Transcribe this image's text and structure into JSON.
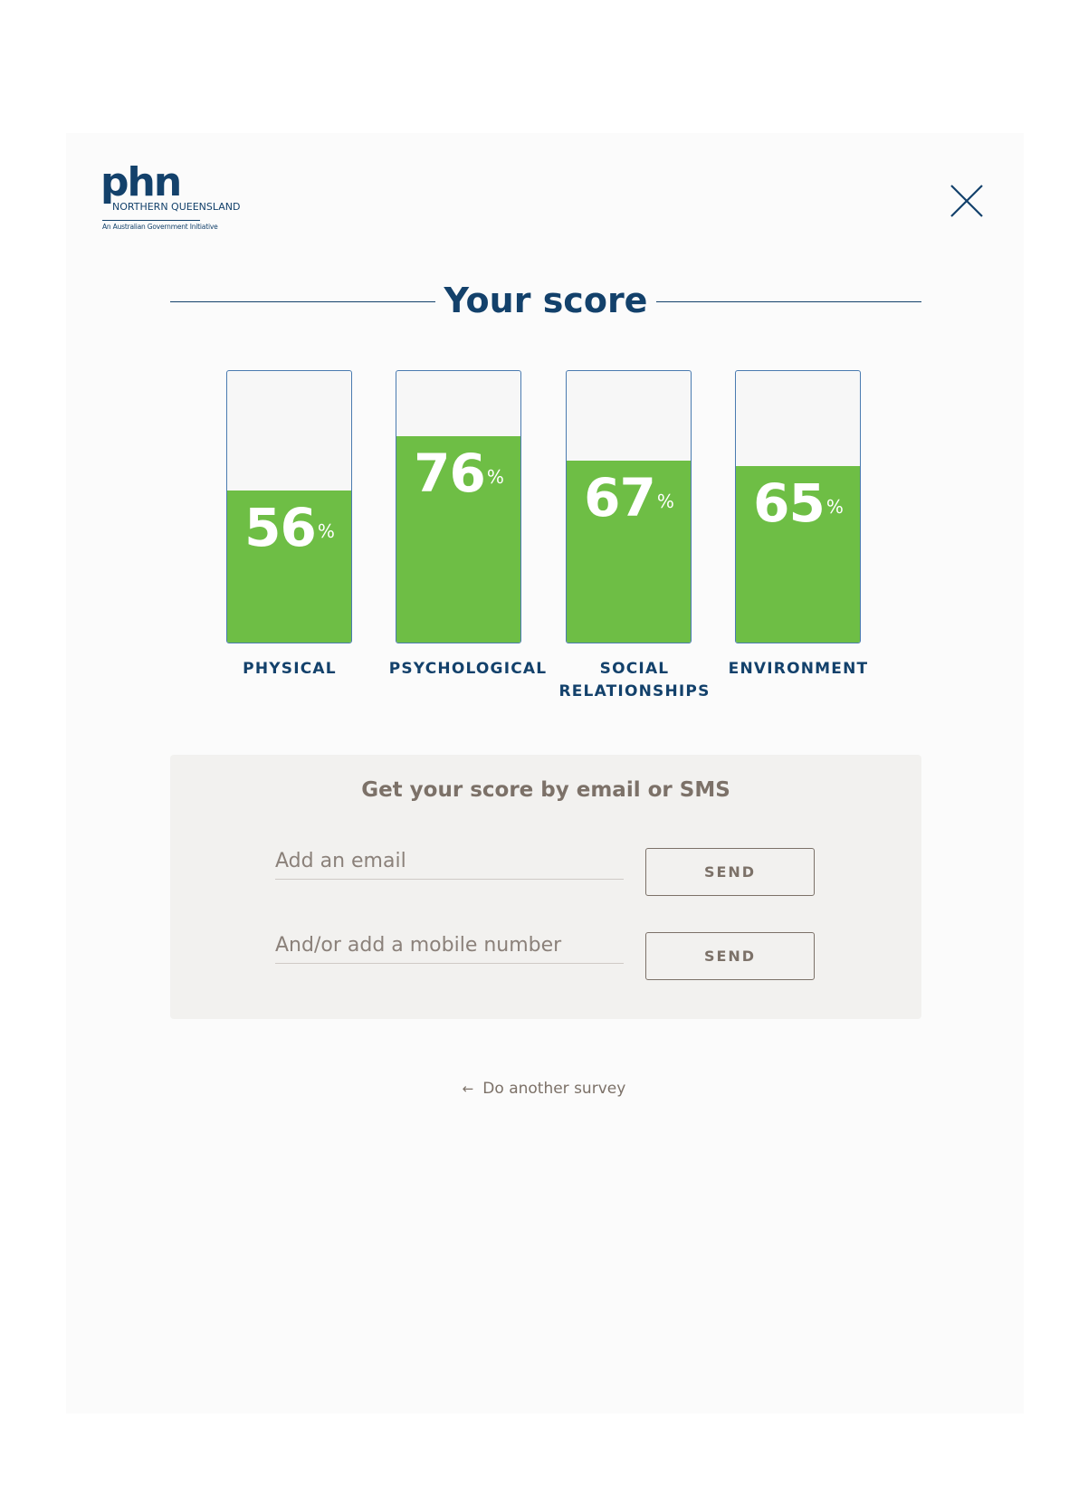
{
  "logo": {
    "mark": "phn",
    "region": "NORTHERN QUEENSLAND",
    "tagline": "An Australian Government Initiative"
  },
  "close": {
    "icon": "close-icon"
  },
  "title": "Your score",
  "scores": [
    {
      "label": "PHYSICAL",
      "value": 56,
      "unit": "%"
    },
    {
      "label": "PSYCHOLOGICAL",
      "value": 76,
      "unit": "%"
    },
    {
      "label": "SOCIAL\nRELATIONSHIPS",
      "value": 67,
      "unit": "%"
    },
    {
      "label": "ENVIRONMENT",
      "value": 65,
      "unit": "%"
    }
  ],
  "send_panel": {
    "title": "Get your score by email or SMS",
    "email_placeholder": "Add an email",
    "email_value": "",
    "mobile_placeholder": "And/or add a mobile number",
    "mobile_value": "",
    "email_send_label": "SEND",
    "mobile_send_label": "SEND"
  },
  "back_link": {
    "icon": "arrow-left-icon",
    "label": "Do another survey"
  },
  "colors": {
    "brand": "#13416b",
    "fill": "#6ebe45",
    "muted": "#7c7168",
    "panel": "#f2f1ef"
  }
}
